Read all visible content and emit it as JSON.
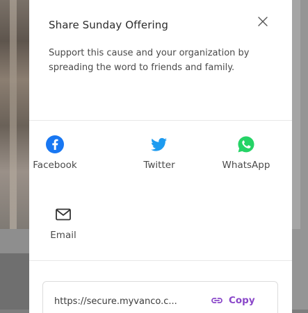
{
  "modal": {
    "title": "Share Sunday Offering",
    "description": "Support this cause and your organization by spreading the word to friends and family.",
    "close_icon": "close-icon"
  },
  "share_options": [
    {
      "label": "Facebook",
      "icon": "facebook-icon",
      "color": "#1877f2"
    },
    {
      "label": "Twitter",
      "icon": "twitter-icon",
      "color": "#1d9bf0"
    },
    {
      "label": "WhatsApp",
      "icon": "whatsapp-icon",
      "color": "#25d366"
    },
    {
      "label": "Email",
      "icon": "mail-icon",
      "color": "#333333"
    }
  ],
  "link": {
    "url_text": "https://secure.myvanco.c...",
    "copy_label": "Copy",
    "copy_icon": "link-icon",
    "accent_color": "#8a47c9"
  }
}
